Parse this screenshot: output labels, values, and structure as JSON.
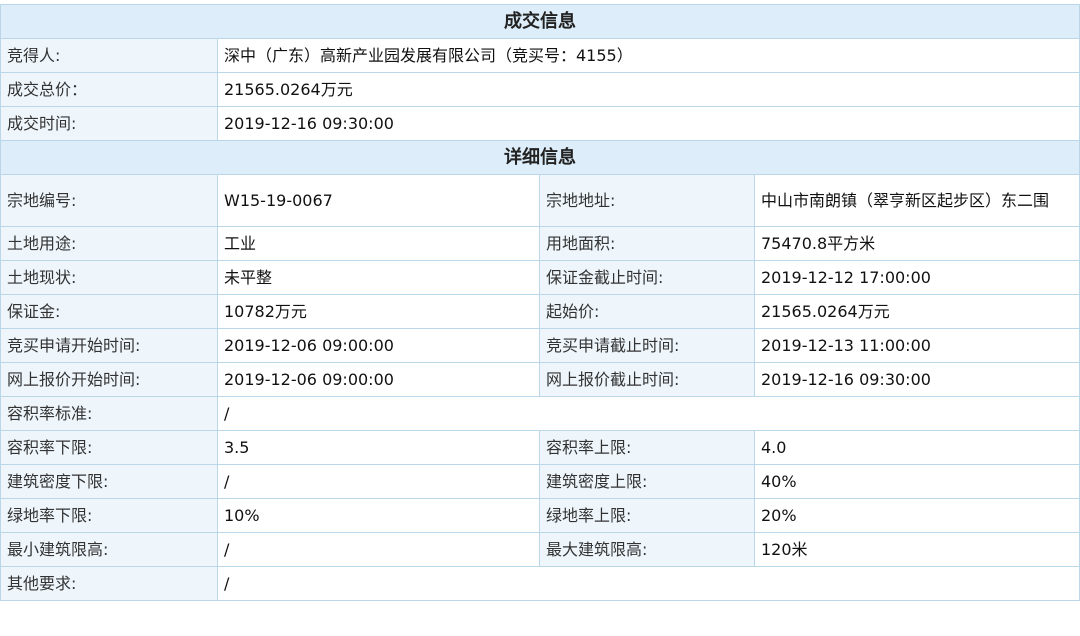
{
  "deal": {
    "title": "成交信息",
    "rows": [
      {
        "label": "竞得人:",
        "value": "深中（广东）高新产业园发展有限公司（竞买号：4155）"
      },
      {
        "label": "成交总价：",
        "value": "21565.0264万元"
      },
      {
        "label": "成交时间:",
        "value": "2019-12-16 09:30:00"
      }
    ]
  },
  "detail": {
    "title": "详细信息",
    "parcel_no_label": "宗地编号:",
    "parcel_no": "W15-19-0067",
    "address_label": "宗地地址:",
    "address": "中山市南朗镇（翠亨新区起步区）东二围",
    "use_label": "土地用途:",
    "use": "工业",
    "area_label": "用地面积:",
    "area": "75470.8平方米",
    "status_label": "土地现状:",
    "status": "未平整",
    "deposit_deadline_label": "保证金截止时间:",
    "deposit_deadline": "2019-12-12 17:00:00",
    "deposit_label": "保证金:",
    "deposit": "10782万元",
    "start_price_label": "起始价:",
    "start_price": "21565.0264万元",
    "apply_start_label": "竞买申请开始时间:",
    "apply_start": "2019-12-06 09:00:00",
    "apply_end_label": "竞买申请截止时间:",
    "apply_end": "2019-12-13 11:00:00",
    "bid_start_label": "网上报价开始时间:",
    "bid_start": "2019-12-06 09:00:00",
    "bid_end_label": "网上报价截止时间:",
    "bid_end": "2019-12-16 09:30:00",
    "far_standard_label": "容积率标准:",
    "far_standard": "/",
    "far_min_label": "容积率下限:",
    "far_min": "3.5",
    "far_max_label": "容积率上限:",
    "far_max": "4.0",
    "density_min_label": "建筑密度下限:",
    "density_min": "/",
    "density_max_label": "建筑密度上限:",
    "density_max": "40%",
    "green_min_label": "绿地率下限:",
    "green_min": "10%",
    "green_max_label": "绿地率上限:",
    "green_max": "20%",
    "height_min_label": "最小建筑限高:",
    "height_min": "/",
    "height_max_label": "最大建筑限高:",
    "height_max": "120米",
    "other_label": "其他要求:",
    "other": "/"
  }
}
